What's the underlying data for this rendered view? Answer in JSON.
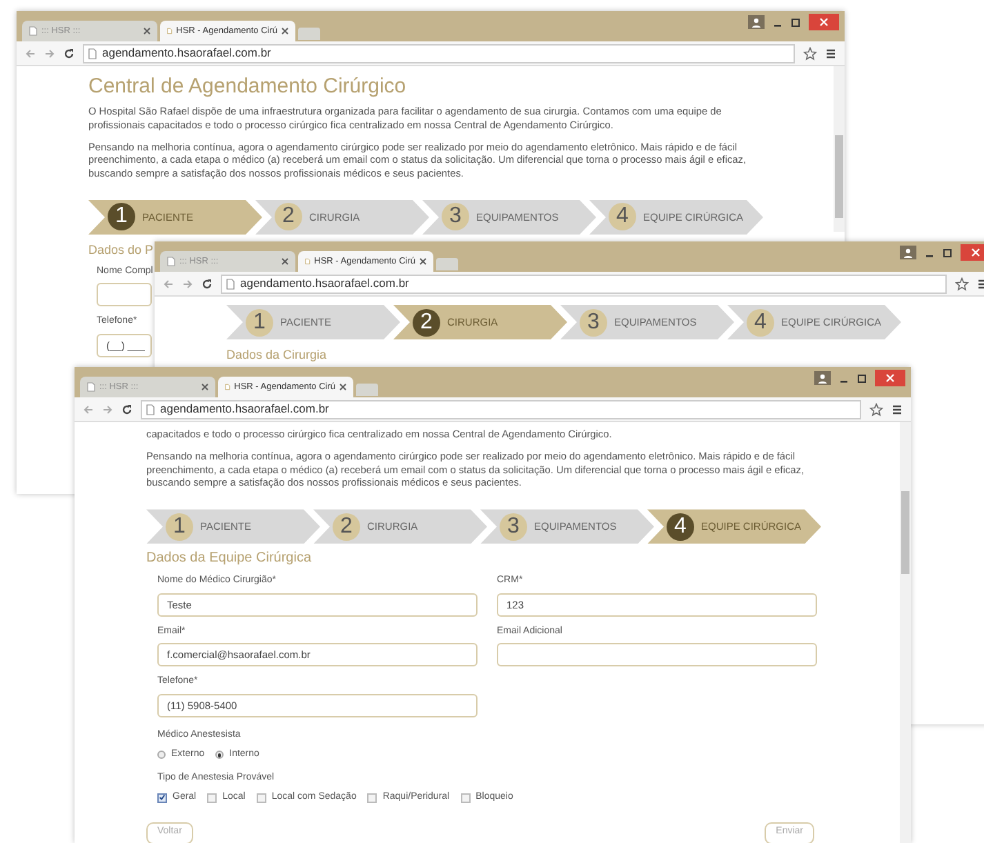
{
  "windows": [
    {
      "tabs": [
        {
          "title": "::: HSR :::",
          "selected": false
        },
        {
          "title": "HSR - Agendamento Cirú",
          "selected": true
        }
      ],
      "url": "agendamento.hsaorafael.com.br",
      "heading": "Central de Agendamento Cirúrgico",
      "paragraphs": [
        "O Hospital São Rafael dispõe de uma infraestrutura organizada para facilitar o agendamento de sua cirurgia. Contamos com uma equipe de profissionais capacitados e todo o processo cirúrgico fica centralizado em nossa Central de Agendamento Cirúrgico.",
        "Pensando na melhoria contínua, agora o agendamento cirúrgico pode ser realizado por meio do agendamento eletrônico. Mais rápido e de fácil preenchimento, a cada etapa o médico (a) receberá um email com o status da solicitação. Um diferencial que torna o processo mais ágil e eficaz, buscando sempre a satisfação dos nossos profissionais médicos e seus pacientes."
      ],
      "steps": [
        {
          "number": "1",
          "label": "PACIENTE",
          "selected": true
        },
        {
          "number": "2",
          "label": "CIRURGIA",
          "selected": false
        },
        {
          "number": "3",
          "label": "EQUIPAMENTOS",
          "selected": false
        },
        {
          "number": "4",
          "label": "EQUIPE CIRÚRGICA",
          "selected": false
        }
      ],
      "section_title": "Dados do P",
      "fields": [
        {
          "label": "Nome Compl"
        },
        {
          "label": "Telefone*",
          "value": "(__) ___"
        }
      ]
    },
    {
      "tabs": [
        {
          "title": "::: HSR :::",
          "selected": false
        },
        {
          "title": "HSR - Agendamento Cirú",
          "selected": true
        }
      ],
      "url": "agendamento.hsaorafael.com.br",
      "steps": [
        {
          "number": "1",
          "label": "PACIENTE",
          "selected": false
        },
        {
          "number": "2",
          "label": "CIRURGIA",
          "selected": true
        },
        {
          "number": "3",
          "label": "EQUIPAMENTOS",
          "selected": false
        },
        {
          "number": "4",
          "label": "EQUIPE CIRÚRGICA",
          "selected": false
        }
      ],
      "section_title": "Dados da Cirurgia"
    },
    {
      "tabs": [
        {
          "title": "::: HSR :::",
          "selected": false
        },
        {
          "title": "HSR - Agendamento Cirú",
          "selected": true
        }
      ],
      "url": "agendamento.hsaorafael.com.br",
      "paragraphs": [
        "capacitados e todo o processo cirúrgico fica centralizado em nossa Central de Agendamento Cirúrgico.",
        "Pensando na melhoria contínua, agora o agendamento cirúrgico pode ser realizado por meio do agendamento eletrônico. Mais rápido e de fácil preenchimento, a cada etapa o médico (a) receberá um email com o status da solicitação. Um diferencial que torna o processo mais ágil e eficaz, buscando sempre a satisfação dos nossos profissionais médicos e seus pacientes."
      ],
      "steps": [
        {
          "number": "1",
          "label": "PACIENTE",
          "selected": false
        },
        {
          "number": "2",
          "label": "CIRURGIA",
          "selected": false
        },
        {
          "number": "3",
          "label": "EQUIPAMENTOS",
          "selected": false
        },
        {
          "number": "4",
          "label": "EQUIPE CIRÚRGICA",
          "selected": true
        }
      ],
      "section_title": "Dados da Equipe Cirúrgica",
      "fields": [
        {
          "label": "Nome do Médico Cirurgião*",
          "value": "Teste"
        },
        {
          "label": "CRM*",
          "value": "123"
        },
        {
          "label": "Email*",
          "value": "f.comercial@hsaorafael.com.br"
        },
        {
          "label": "Email Adicional"
        },
        {
          "label": "Telefone*",
          "value": "(11) 5908-5400"
        }
      ],
      "radio_group": {
        "label": "Médico Anestesista",
        "options": [
          {
            "label": "Externo",
            "selected": false
          },
          {
            "label": "Interno",
            "selected": true
          }
        ]
      },
      "checkbox_group": {
        "label": "Tipo de Anestesia Provável",
        "options": [
          {
            "label": "Geral",
            "checked": true
          },
          {
            "label": "Local",
            "checked": false
          },
          {
            "label": "Local com Sedação",
            "checked": false
          },
          {
            "label": "Raqui/Peridural",
            "checked": false
          },
          {
            "label": "Bloqueio",
            "checked": false
          }
        ]
      },
      "buttons": [
        "Voltar",
        "Enviar"
      ]
    }
  ]
}
